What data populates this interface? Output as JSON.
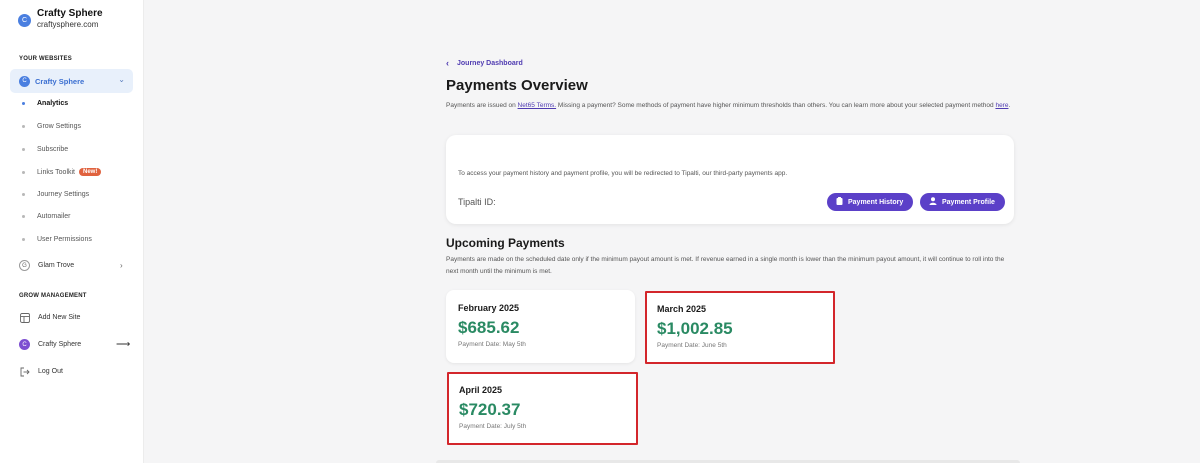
{
  "sidebar": {
    "brand": {
      "initial": "C",
      "name": "Crafty Sphere",
      "domain": "craftysphere.com"
    },
    "your_websites_title": "YOUR WEBSITES",
    "selected_site": {
      "initial": "C",
      "label": "Crafty Sphere"
    },
    "sub_items": [
      {
        "label": "Analytics"
      },
      {
        "label": "Grow Settings"
      },
      {
        "label": "Subscribe"
      },
      {
        "label": "Links Toolkit",
        "badge": "New!"
      },
      {
        "label": "Journey Settings"
      },
      {
        "label": "Automailer"
      },
      {
        "label": "User Permissions"
      }
    ],
    "other_site": {
      "initial": "G",
      "label": "Glam Trove"
    },
    "grow_management_title": "GROW MANAGEMENT",
    "add_new_site": "Add New Site",
    "switch_site": {
      "initial": "C",
      "label": "Crafty Sphere"
    },
    "log_out": "Log Out"
  },
  "main": {
    "back_link": "Journey Dashboard",
    "title": "Payments Overview",
    "intro_before": "Payments are issued on ",
    "intro_link": "Net65 Terms.",
    "intro_middle": " Missing a payment? Some methods of payment have higher minimum thresholds than others. You can learn more about your selected payment method ",
    "intro_here": "here",
    "intro_end": ".",
    "info_card": {
      "text": "To access your payment history and payment profile, you will be redirected to Tipalti, our third-party payments app.",
      "tipalti_label": "Tipalti ID:",
      "history_button": "Payment History",
      "profile_button": "Payment Profile"
    },
    "upcoming_title": "Upcoming Payments",
    "upcoming_desc": "Payments are made on the scheduled date only if the minimum payout amount is met. If revenue earned in a single month is lower than the minimum payout amount, it will continue to roll into the next month until the minimum is met.",
    "payments": [
      {
        "month": "February 2025",
        "amount": "$685.62",
        "date": "Payment Date: May 5th"
      },
      {
        "month": "March 2025",
        "amount": "$1,002.85",
        "date": "Payment Date: June 5th"
      },
      {
        "month": "April 2025",
        "amount": "$720.37",
        "date": "Payment Date: July 5th"
      }
    ]
  },
  "colors": {
    "accent": "#5b40c8",
    "money": "#2a8a63",
    "highlight": "#d3262b",
    "sidebar_active": "#4a7fe0"
  }
}
